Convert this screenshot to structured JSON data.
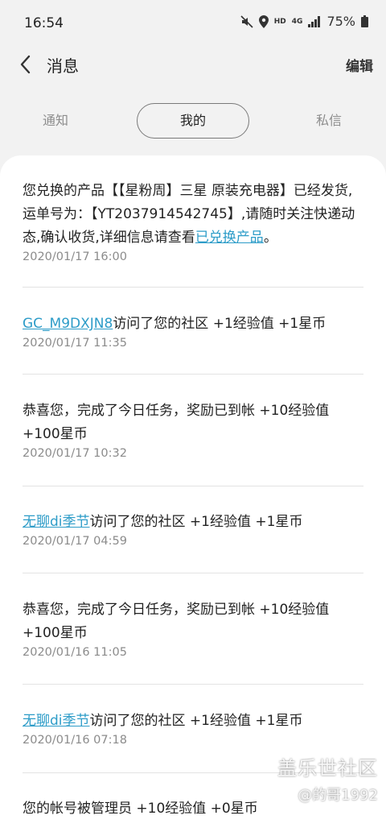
{
  "status_bar": {
    "time": "16:54",
    "battery": "75%",
    "hd": "HD",
    "network": "4G"
  },
  "app_bar": {
    "title": "消息",
    "edit_label": "编辑"
  },
  "tabs": [
    {
      "label": "通知"
    },
    {
      "label": "我的",
      "selected": true
    },
    {
      "label": "私信"
    }
  ],
  "messages": [
    {
      "prefix": "您兑换的产品【【星粉周】三星 原装充电器】已经发货,运单号为：【YT2037914542745】,请随时关注快递动态,确认收货,详细信息请查看",
      "link": "已兑换产品",
      "suffix": "。",
      "time": "2020/01/17 16:00"
    },
    {
      "link": "GC_M9DXJN8",
      "suffix": "访问了您的社区 +1经验值 +1星币",
      "time": "2020/01/17 11:35"
    },
    {
      "text": "恭喜您，完成了今日任务，奖励已到帐 +10经验值 +100星币",
      "time": "2020/01/17 10:32"
    },
    {
      "link": "无聊di季节",
      "suffix": "访问了您的社区 +1经验值 +1星币",
      "time": "2020/01/17 04:59"
    },
    {
      "text": "恭喜您，完成了今日任务，奖励已到帐 +10经验值 +100星币",
      "time": "2020/01/16 11:05"
    },
    {
      "link": "无聊di季节",
      "suffix": "访问了您的社区 +1经验值 +1星币",
      "time": "2020/01/16 07:18"
    },
    {
      "text": "您的帐号被管理员 +10经验值 +0星币"
    }
  ],
  "watermark": {
    "logo": "盖乐世社区",
    "user": "@的哥1992"
  },
  "colors": {
    "link": "#2d9cc8",
    "background": "#f2f2f2",
    "card": "#ffffff"
  }
}
